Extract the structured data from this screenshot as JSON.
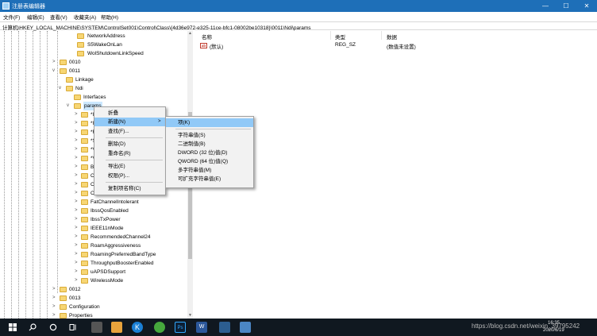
{
  "window": {
    "title": "注册表编辑器",
    "minimize": "—",
    "maximize": "☐",
    "close": "✕"
  },
  "menubar": [
    "文件(F)",
    "编辑(E)",
    "查看(V)",
    "收藏夹(A)",
    "帮助(H)"
  ],
  "address": "计算机\\HKEY_LOCAL_MACHINE\\SYSTEM\\ControlSet001\\Control\\Class\\{4d36e972-e325-11ce-bfc1-08002be10318}\\0011\\Ndi\\params",
  "tree": [
    {
      "label": "NetworkAddress",
      "toggle": ""
    },
    {
      "label": "S5WakeOnLan",
      "toggle": ""
    },
    {
      "label": "WolShutdownLinkSpeed",
      "toggle": ""
    },
    {
      "label": "0010",
      "toggle": ">"
    },
    {
      "label": "0011",
      "toggle": "v"
    },
    {
      "label": "Linkage",
      "toggle": ""
    },
    {
      "label": "Ndi",
      "toggle": "v"
    },
    {
      "label": "Interfaces",
      "toggle": ""
    },
    {
      "label": "params",
      "toggle": "v"
    },
    {
      "label": "*I",
      "toggle": ">"
    },
    {
      "label": "*I",
      "toggle": ">"
    },
    {
      "label": "*F",
      "toggle": ">"
    },
    {
      "label": "*S",
      "toggle": ">"
    },
    {
      "label": "*V",
      "toggle": ">"
    },
    {
      "label": "*V",
      "toggle": ">"
    },
    {
      "label": "B",
      "toggle": ">"
    },
    {
      "label": "C",
      "toggle": ">"
    },
    {
      "label": "C",
      "toggle": ">"
    },
    {
      "label": "C",
      "toggle": ">"
    },
    {
      "label": "FatChannelIntolerant",
      "toggle": ">"
    },
    {
      "label": "IbssQosEnabled",
      "toggle": ">"
    },
    {
      "label": "IbssTxPower",
      "toggle": ">"
    },
    {
      "label": "IEEE11nMode",
      "toggle": ">"
    },
    {
      "label": "RecommendedChannel24",
      "toggle": ">"
    },
    {
      "label": "RoamAggressiveness",
      "toggle": ">"
    },
    {
      "label": "RoamingPreferredBandType",
      "toggle": ">"
    },
    {
      "label": "ThroughputBoosterEnabled",
      "toggle": ">"
    },
    {
      "label": "uAPSDSupport",
      "toggle": ">"
    },
    {
      "label": "WirelessMode",
      "toggle": ">"
    },
    {
      "label": "0012",
      "toggle": ">"
    },
    {
      "label": "0013",
      "toggle": ">"
    },
    {
      "label": "Configuration",
      "toggle": ">"
    },
    {
      "label": "Properties",
      "toggle": ">"
    }
  ],
  "list": {
    "headers": {
      "name": "名称",
      "type": "类型",
      "data": "数据"
    },
    "rows": [
      {
        "icon": "ab",
        "name": "(默认)",
        "type": "REG_SZ",
        "data": "(数值未设置)"
      }
    ]
  },
  "context_menu": {
    "items": [
      "折叠",
      "新建(N)",
      "查找(F)...",
      "删除(D)",
      "重命名(R)",
      "导出(E)",
      "权限(P)...",
      "复制项名称(C)"
    ],
    "arrow": ">"
  },
  "submenu": {
    "items": [
      "项(K)",
      "字符串值(S)",
      "二进制值(B)",
      "DWORD (32 位)值(D)",
      "QWORD (64 位)值(Q)",
      "多字符串值(M)",
      "可扩充字符串值(E)"
    ]
  },
  "taskbar": {
    "time": "16:35",
    "date": "2020/6/19",
    "watermark": "https://blog.csdn.net/weixin_39795242"
  },
  "icons": {
    "start": "windows-logo-icon",
    "search": "search-icon",
    "cortana": "cortana-icon",
    "taskview": "task-view-icon"
  }
}
